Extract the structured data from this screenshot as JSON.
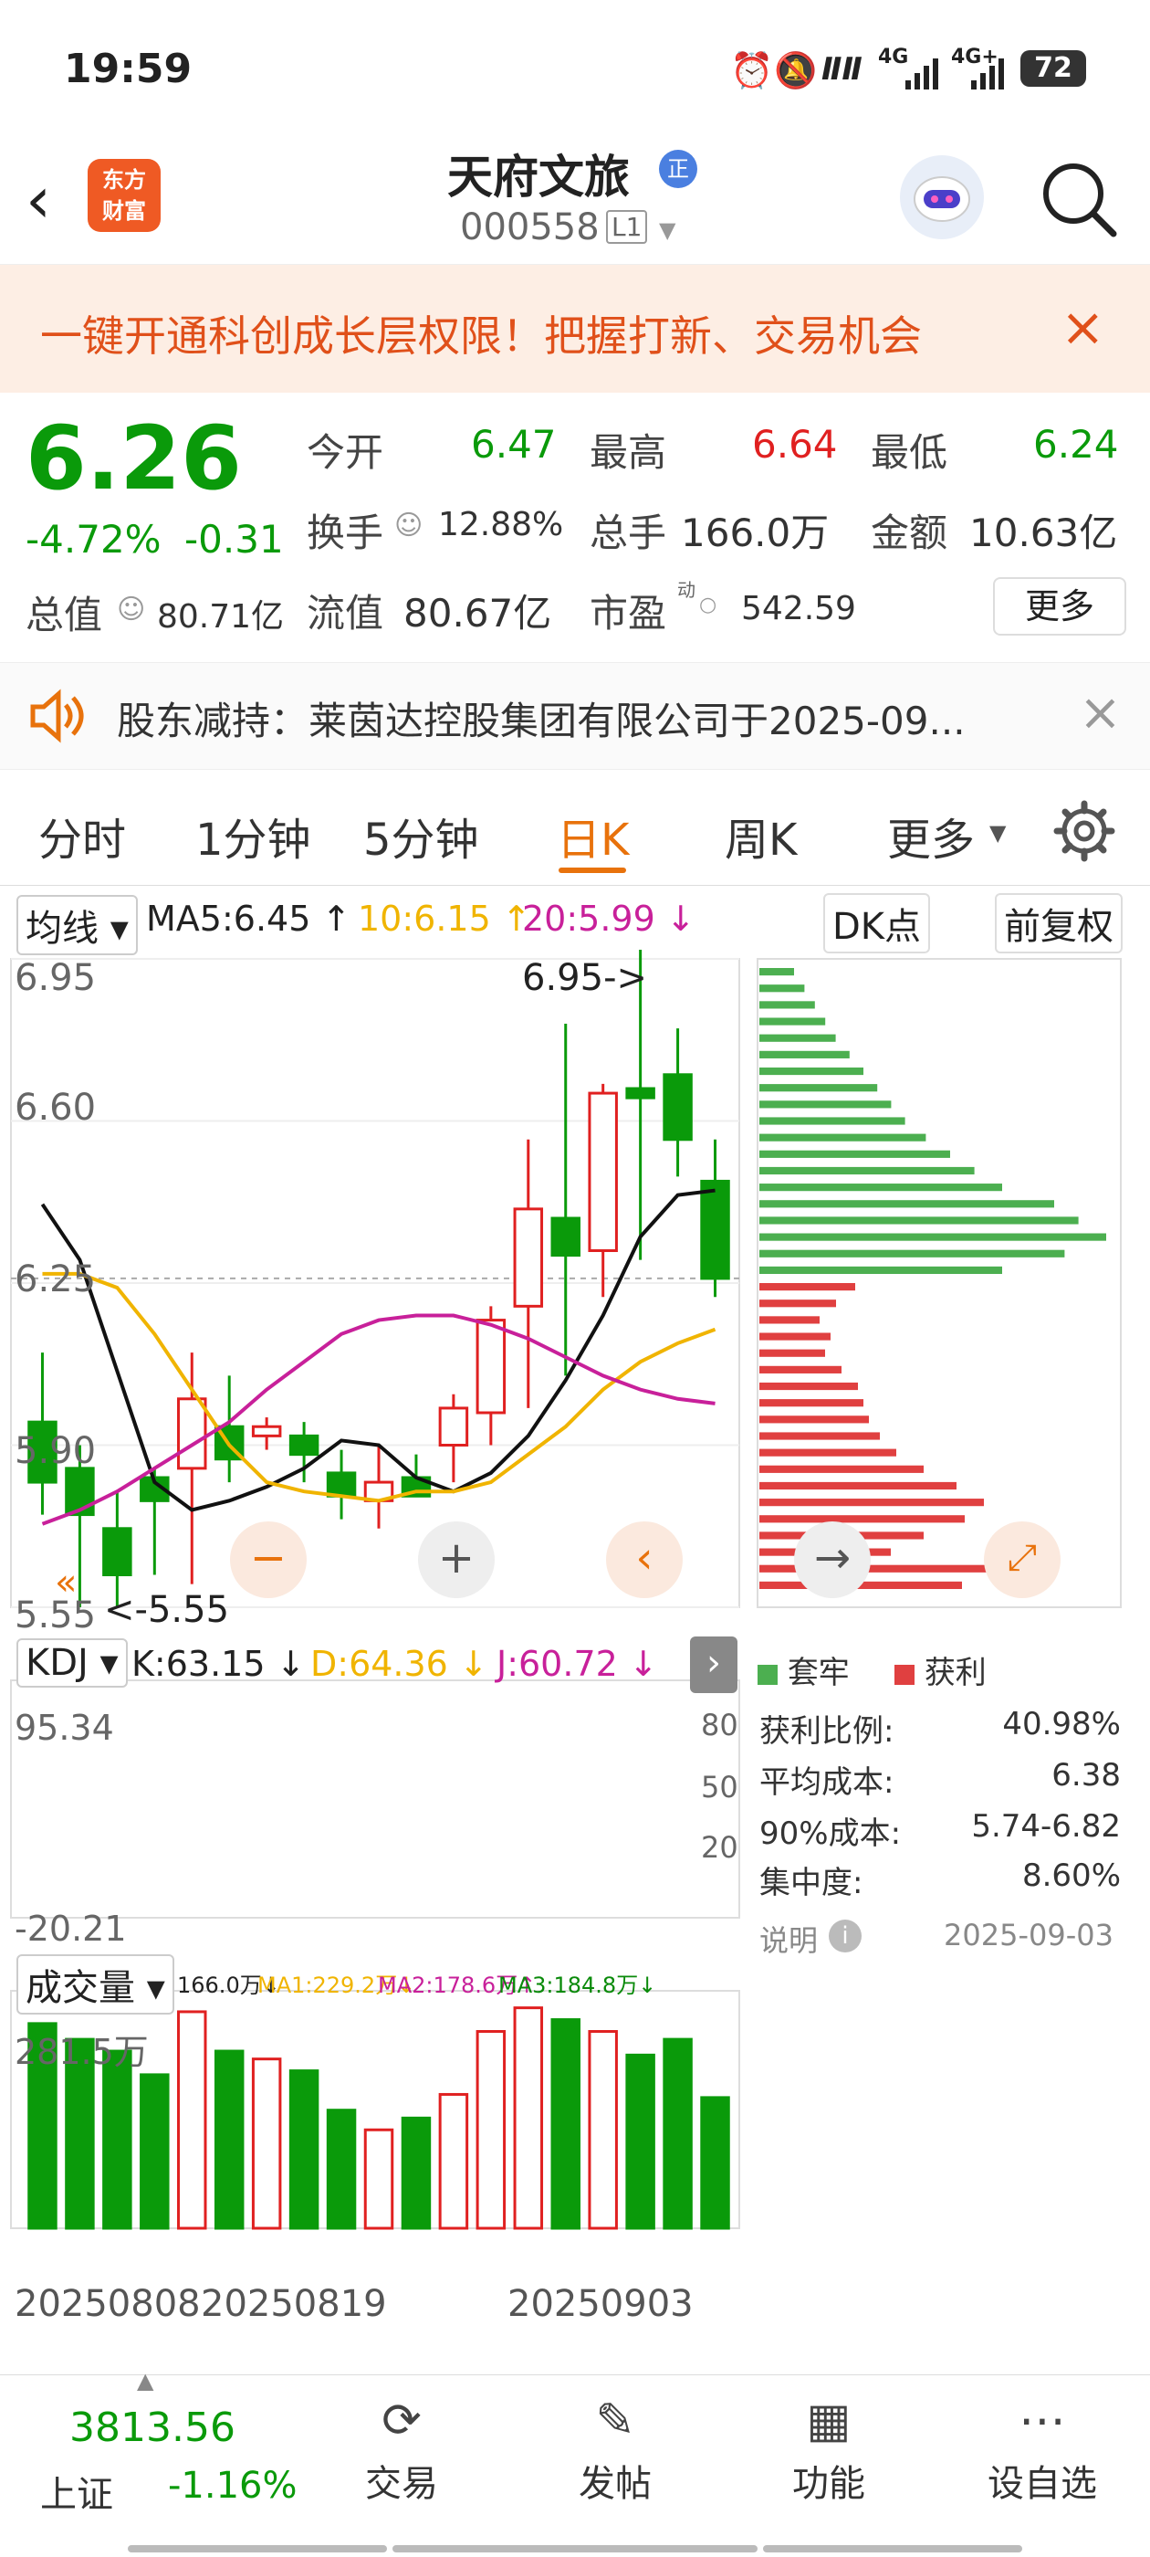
{
  "status": {
    "time": "19:59",
    "battery": "72",
    "net1": "4G",
    "net2": "4G+"
  },
  "header": {
    "brand": "东方\n财富",
    "title": "天府文旅",
    "title_badge": "正",
    "code": "000558",
    "level": "L1"
  },
  "promo": {
    "text": "一键开通科创成长层权限！把握打新、交易机会"
  },
  "quote": {
    "price": "6.26",
    "change_pct": "-4.72%",
    "change": "-0.31",
    "open_label": "今开",
    "open": "6.47",
    "high_label": "最高",
    "high": "6.64",
    "low_label": "最低",
    "low": "6.24",
    "turnover_label": "换手",
    "turnover": "12.88%",
    "volume_label": "总手",
    "volume": "166.0万",
    "amount_label": "金额",
    "amount": "10.63亿",
    "mcap_label": "总值",
    "mcap": "80.71亿",
    "float_label": "流值",
    "float": "80.67亿",
    "pe_label": "市盈",
    "pe_sup": "动",
    "pe": "542.59",
    "more": "更多"
  },
  "notice": {
    "text": "股东减持：莱茵达控股集团有限公司于2025-09..."
  },
  "tabs": [
    "分时",
    "1分钟",
    "5分钟",
    "日K",
    "周K",
    "更多"
  ],
  "active_tab": "日K",
  "kline": {
    "ma_select": "均线",
    "ma5": "MA5:6.45 ↑",
    "ma10": "10:6.15 ↑",
    "ma20": "20:5.99 ↓",
    "dk_btn": "DK点",
    "fq_btn": "前复权",
    "y_labels": [
      "6.95",
      "6.60",
      "6.25",
      "5.90",
      "5.55"
    ],
    "max_label": "6.95->",
    "min_label": "<-5.55",
    "kdj_select": "KDJ",
    "k": "K:63.15 ↓",
    "d": "D:64.36 ↓",
    "j": "J:60.72 ↓",
    "kdj_top": "95.34",
    "kdj_bottom": "-20.21",
    "kdj_r80": "80",
    "kdj_r50": "50",
    "kdj_r20": "20",
    "vol_select": "成交量",
    "vol_total": "166.0万↓",
    "vol_ma1": "MA1:229.2万↓",
    "vol_ma2": "MA2:178.6万↑",
    "vol_ma3": "MA3:184.8万↓",
    "vol_top": "281.5万",
    "dates": [
      "20250808",
      "20250819",
      "20250903"
    ]
  },
  "chips": {
    "legend_trapped": "套牢",
    "legend_profit": "获利",
    "rows": [
      {
        "label": "获利比例:",
        "value": "40.98%"
      },
      {
        "label": "平均成本:",
        "value": "6.38"
      },
      {
        "label": "90%成本:",
        "value": "5.74-6.82"
      },
      {
        "label": "集中度:",
        "value": "8.60%"
      }
    ],
    "note": "说明",
    "date": "2025-09-03"
  },
  "chart_data": {
    "type": "candlestick",
    "x": [
      "1",
      "2",
      "3",
      "4",
      "5",
      "6",
      "7",
      "8",
      "9",
      "10",
      "11",
      "12",
      "13",
      "14",
      "15",
      "16",
      "17",
      "18",
      "19"
    ],
    "open": [
      5.95,
      5.85,
      5.72,
      5.83,
      5.85,
      5.94,
      5.92,
      5.92,
      5.84,
      5.78,
      5.83,
      5.9,
      5.97,
      6.2,
      6.39,
      6.32,
      6.67,
      6.7,
      6.47
    ],
    "close": [
      5.82,
      5.75,
      5.62,
      5.78,
      6.0,
      5.87,
      5.94,
      5.88,
      5.79,
      5.82,
      5.79,
      5.98,
      6.17,
      6.41,
      6.31,
      6.66,
      6.65,
      6.56,
      6.26
    ],
    "high": [
      6.1,
      5.9,
      5.8,
      5.85,
      6.1,
      6.05,
      5.96,
      5.95,
      5.89,
      5.9,
      5.88,
      6.01,
      6.2,
      6.56,
      6.81,
      6.68,
      6.98,
      6.8,
      6.56
    ],
    "low": [
      5.75,
      5.55,
      5.55,
      5.62,
      5.6,
      5.82,
      5.89,
      5.82,
      5.74,
      5.72,
      5.79,
      5.82,
      5.9,
      5.98,
      6.05,
      6.22,
      6.3,
      6.48,
      6.22
    ],
    "ma5": [
      6.42,
      6.3,
      6.06,
      5.82,
      5.76,
      5.78,
      5.81,
      5.85,
      5.91,
      5.9,
      5.83,
      5.8,
      5.84,
      5.92,
      6.04,
      6.18,
      6.35,
      6.44,
      6.45
    ],
    "ma10": [
      6.27,
      6.27,
      6.24,
      6.14,
      6.02,
      5.9,
      5.82,
      5.8,
      5.79,
      5.78,
      5.8,
      5.8,
      5.82,
      5.88,
      5.94,
      6.02,
      6.08,
      6.12,
      6.15
    ],
    "ma20": [
      5.73,
      5.76,
      5.8,
      5.85,
      5.9,
      5.95,
      6.02,
      6.08,
      6.14,
      6.17,
      6.18,
      6.18,
      6.16,
      6.13,
      6.09,
      6.05,
      6.02,
      6.0,
      5.99
    ],
    "volume": [
      260,
      240,
      225,
      195,
      275,
      225,
      215,
      200,
      150,
      125,
      140,
      170,
      250,
      280,
      265,
      250,
      220,
      240,
      166
    ],
    "chips_trapped": [
      10,
      13,
      16,
      19,
      22,
      26,
      30,
      34,
      38,
      42,
      48,
      55,
      62,
      70,
      85,
      92,
      100,
      88,
      70
    ],
    "chips_profit": [
      35,
      28,
      22,
      26,
      24,
      30,
      36,
      38,
      40,
      44,
      50,
      60,
      72,
      82,
      75,
      60,
      48,
      90,
      74
    ]
  }
}
